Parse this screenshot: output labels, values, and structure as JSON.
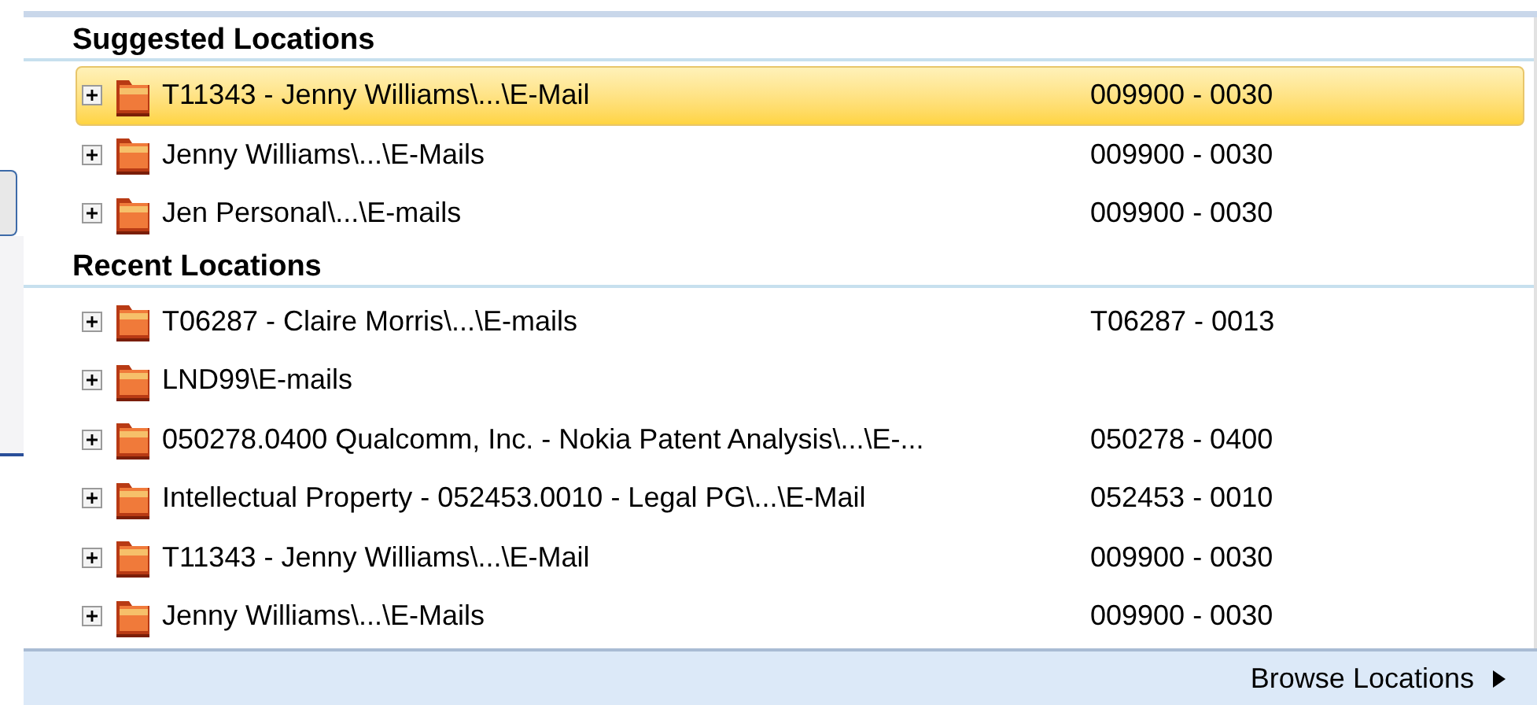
{
  "sections": [
    {
      "heading": "Suggested Locations",
      "items": [
        {
          "label": "T11343 - Jenny Williams\\...\\E-Mail",
          "code": "009900 - 0030",
          "selected": true
        },
        {
          "label": "Jenny Williams\\...\\E-Mails",
          "code": "009900 - 0030",
          "selected": false
        },
        {
          "label": "Jen Personal\\...\\E-mails",
          "code": "009900 - 0030",
          "selected": false
        }
      ]
    },
    {
      "heading": "Recent Locations",
      "items": [
        {
          "label": "T06287 - Claire Morris\\...\\E-mails",
          "code": "T06287 - 0013",
          "selected": false
        },
        {
          "label": "LND99\\E-mails",
          "selected": false
        },
        {
          "label": "050278.0400 Qualcomm, Inc. - Nokia Patent Analysis\\...\\E-...",
          "code": "050278 - 0400",
          "selected": false
        },
        {
          "label": "Intellectual Property - 052453.0010 - Legal PG\\...\\E-Mail",
          "code": "052453 - 0010",
          "selected": false
        },
        {
          "label": "T11343 - Jenny Williams\\...\\E-Mail",
          "code": "009900 - 0030",
          "selected": false
        },
        {
          "label": "Jenny Williams\\...\\E-Mails",
          "code": "009900 - 0030",
          "selected": false
        }
      ]
    }
  ],
  "footer": {
    "link": "Browse Locations"
  }
}
